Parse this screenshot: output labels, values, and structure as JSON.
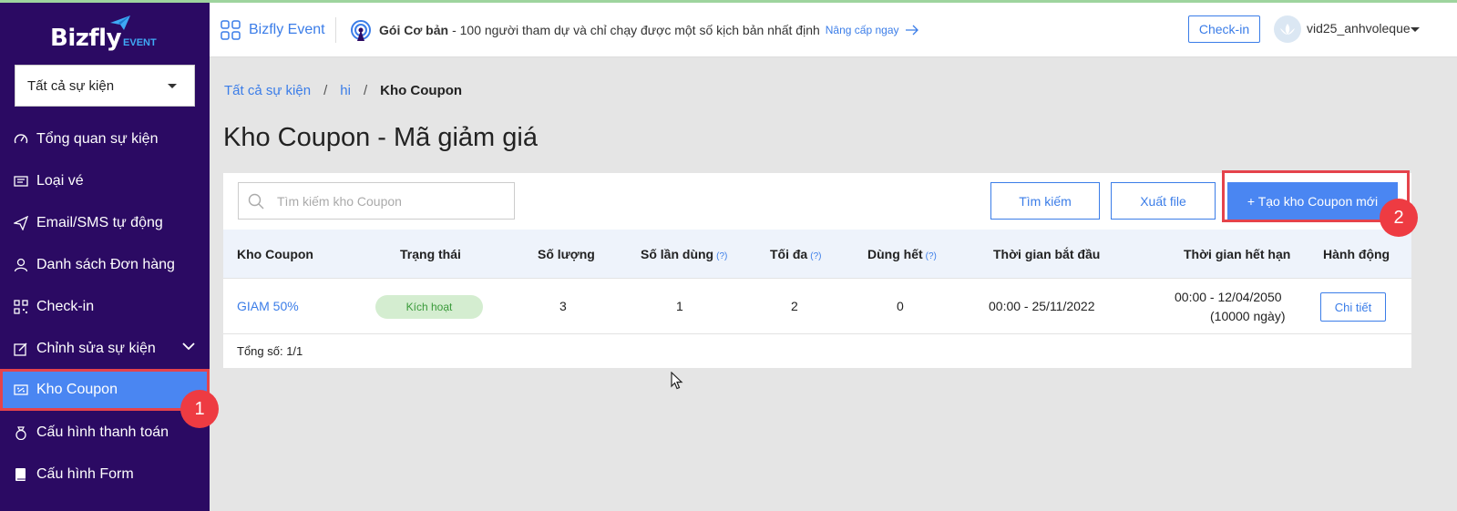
{
  "brand": {
    "name": "Bizfly",
    "sub": "EVENT"
  },
  "sidebar": {
    "event_select": "Tất cả sự kiện",
    "items": [
      {
        "label": "Tổng quan sự kiện",
        "icon": "speedometer-icon"
      },
      {
        "label": "Loại vé",
        "icon": "ticket-icon"
      },
      {
        "label": "Email/SMS tự động",
        "icon": "send-icon"
      },
      {
        "label": "Danh sách Đơn hàng",
        "icon": "user-icon"
      },
      {
        "label": "Check-in",
        "icon": "qr-icon"
      },
      {
        "label": "Chỉnh sửa sự kiện",
        "icon": "edit-icon"
      },
      {
        "label": "Kho Coupon",
        "icon": "coupon-icon"
      },
      {
        "label": "Cấu hình thanh toán",
        "icon": "money-bag-icon"
      },
      {
        "label": "Cấu hình Form",
        "icon": "book-icon"
      }
    ]
  },
  "markers": {
    "one": "1",
    "two": "2"
  },
  "header": {
    "app_name": "Bizfly Event",
    "plan_name": "Gói Cơ bản",
    "plan_desc": "- 100 người tham dự và chỉ chạy được một số kịch bản nhất định",
    "upgrade": "Nâng cấp ngay",
    "checkin": "Check-in",
    "username": "vid25_anhvoleque"
  },
  "breadcrumb": {
    "all": "Tất cả sự kiện",
    "event": "hi",
    "current": "Kho Coupon"
  },
  "page_title": "Kho Coupon - Mã giảm giá",
  "toolbar": {
    "search_placeholder": "Tìm kiếm kho Coupon",
    "search_btn": "Tìm kiếm",
    "export_btn": "Xuất file",
    "create_btn": "+ Tạo kho Coupon mới"
  },
  "table": {
    "headers": {
      "coupon": "Kho Coupon",
      "status": "Trạng thái",
      "quantity": "Số lượng",
      "used": "Số lần dùng",
      "max": "Tối đa",
      "exhausted": "Dùng hết",
      "start": "Thời gian bắt đầu",
      "end": "Thời gian hết hạn",
      "action": "Hành động",
      "help": "(?)"
    },
    "rows": [
      {
        "coupon": "GIAM 50%",
        "status": "Kích hoạt",
        "quantity": "3",
        "used": "1",
        "max": "2",
        "exhausted": "0",
        "start": "00:00 - 25/11/2022",
        "end_time": "00:00 - 12/04/2050",
        "end_days": "(10000 ngày)",
        "action": "Chi tiết"
      }
    ],
    "total": "Tổng số: 1/1"
  },
  "colors": {
    "sidebar": "#2b0a63",
    "accent": "#4a86f2",
    "highlight": "#e5434b",
    "status_bg": "#d4edd0"
  }
}
